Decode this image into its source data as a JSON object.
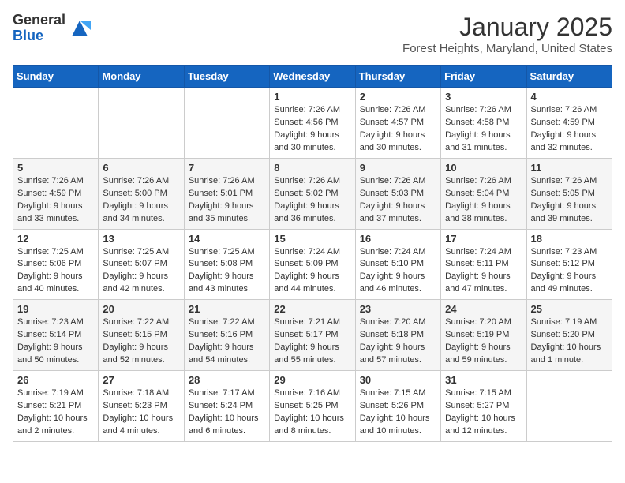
{
  "header": {
    "logo_general": "General",
    "logo_blue": "Blue",
    "month_title": "January 2025",
    "location": "Forest Heights, Maryland, United States"
  },
  "days_of_week": [
    "Sunday",
    "Monday",
    "Tuesday",
    "Wednesday",
    "Thursday",
    "Friday",
    "Saturday"
  ],
  "weeks": [
    [
      {
        "day": "",
        "info": ""
      },
      {
        "day": "",
        "info": ""
      },
      {
        "day": "",
        "info": ""
      },
      {
        "day": "1",
        "info": "Sunrise: 7:26 AM\nSunset: 4:56 PM\nDaylight: 9 hours\nand 30 minutes."
      },
      {
        "day": "2",
        "info": "Sunrise: 7:26 AM\nSunset: 4:57 PM\nDaylight: 9 hours\nand 30 minutes."
      },
      {
        "day": "3",
        "info": "Sunrise: 7:26 AM\nSunset: 4:58 PM\nDaylight: 9 hours\nand 31 minutes."
      },
      {
        "day": "4",
        "info": "Sunrise: 7:26 AM\nSunset: 4:59 PM\nDaylight: 9 hours\nand 32 minutes."
      }
    ],
    [
      {
        "day": "5",
        "info": "Sunrise: 7:26 AM\nSunset: 4:59 PM\nDaylight: 9 hours\nand 33 minutes."
      },
      {
        "day": "6",
        "info": "Sunrise: 7:26 AM\nSunset: 5:00 PM\nDaylight: 9 hours\nand 34 minutes."
      },
      {
        "day": "7",
        "info": "Sunrise: 7:26 AM\nSunset: 5:01 PM\nDaylight: 9 hours\nand 35 minutes."
      },
      {
        "day": "8",
        "info": "Sunrise: 7:26 AM\nSunset: 5:02 PM\nDaylight: 9 hours\nand 36 minutes."
      },
      {
        "day": "9",
        "info": "Sunrise: 7:26 AM\nSunset: 5:03 PM\nDaylight: 9 hours\nand 37 minutes."
      },
      {
        "day": "10",
        "info": "Sunrise: 7:26 AM\nSunset: 5:04 PM\nDaylight: 9 hours\nand 38 minutes."
      },
      {
        "day": "11",
        "info": "Sunrise: 7:26 AM\nSunset: 5:05 PM\nDaylight: 9 hours\nand 39 minutes."
      }
    ],
    [
      {
        "day": "12",
        "info": "Sunrise: 7:25 AM\nSunset: 5:06 PM\nDaylight: 9 hours\nand 40 minutes."
      },
      {
        "day": "13",
        "info": "Sunrise: 7:25 AM\nSunset: 5:07 PM\nDaylight: 9 hours\nand 42 minutes."
      },
      {
        "day": "14",
        "info": "Sunrise: 7:25 AM\nSunset: 5:08 PM\nDaylight: 9 hours\nand 43 minutes."
      },
      {
        "day": "15",
        "info": "Sunrise: 7:24 AM\nSunset: 5:09 PM\nDaylight: 9 hours\nand 44 minutes."
      },
      {
        "day": "16",
        "info": "Sunrise: 7:24 AM\nSunset: 5:10 PM\nDaylight: 9 hours\nand 46 minutes."
      },
      {
        "day": "17",
        "info": "Sunrise: 7:24 AM\nSunset: 5:11 PM\nDaylight: 9 hours\nand 47 minutes."
      },
      {
        "day": "18",
        "info": "Sunrise: 7:23 AM\nSunset: 5:12 PM\nDaylight: 9 hours\nand 49 minutes."
      }
    ],
    [
      {
        "day": "19",
        "info": "Sunrise: 7:23 AM\nSunset: 5:14 PM\nDaylight: 9 hours\nand 50 minutes."
      },
      {
        "day": "20",
        "info": "Sunrise: 7:22 AM\nSunset: 5:15 PM\nDaylight: 9 hours\nand 52 minutes."
      },
      {
        "day": "21",
        "info": "Sunrise: 7:22 AM\nSunset: 5:16 PM\nDaylight: 9 hours\nand 54 minutes."
      },
      {
        "day": "22",
        "info": "Sunrise: 7:21 AM\nSunset: 5:17 PM\nDaylight: 9 hours\nand 55 minutes."
      },
      {
        "day": "23",
        "info": "Sunrise: 7:20 AM\nSunset: 5:18 PM\nDaylight: 9 hours\nand 57 minutes."
      },
      {
        "day": "24",
        "info": "Sunrise: 7:20 AM\nSunset: 5:19 PM\nDaylight: 9 hours\nand 59 minutes."
      },
      {
        "day": "25",
        "info": "Sunrise: 7:19 AM\nSunset: 5:20 PM\nDaylight: 10 hours\nand 1 minute."
      }
    ],
    [
      {
        "day": "26",
        "info": "Sunrise: 7:19 AM\nSunset: 5:21 PM\nDaylight: 10 hours\nand 2 minutes."
      },
      {
        "day": "27",
        "info": "Sunrise: 7:18 AM\nSunset: 5:23 PM\nDaylight: 10 hours\nand 4 minutes."
      },
      {
        "day": "28",
        "info": "Sunrise: 7:17 AM\nSunset: 5:24 PM\nDaylight: 10 hours\nand 6 minutes."
      },
      {
        "day": "29",
        "info": "Sunrise: 7:16 AM\nSunset: 5:25 PM\nDaylight: 10 hours\nand 8 minutes."
      },
      {
        "day": "30",
        "info": "Sunrise: 7:15 AM\nSunset: 5:26 PM\nDaylight: 10 hours\nand 10 minutes."
      },
      {
        "day": "31",
        "info": "Sunrise: 7:15 AM\nSunset: 5:27 PM\nDaylight: 10 hours\nand 12 minutes."
      },
      {
        "day": "",
        "info": ""
      }
    ]
  ]
}
